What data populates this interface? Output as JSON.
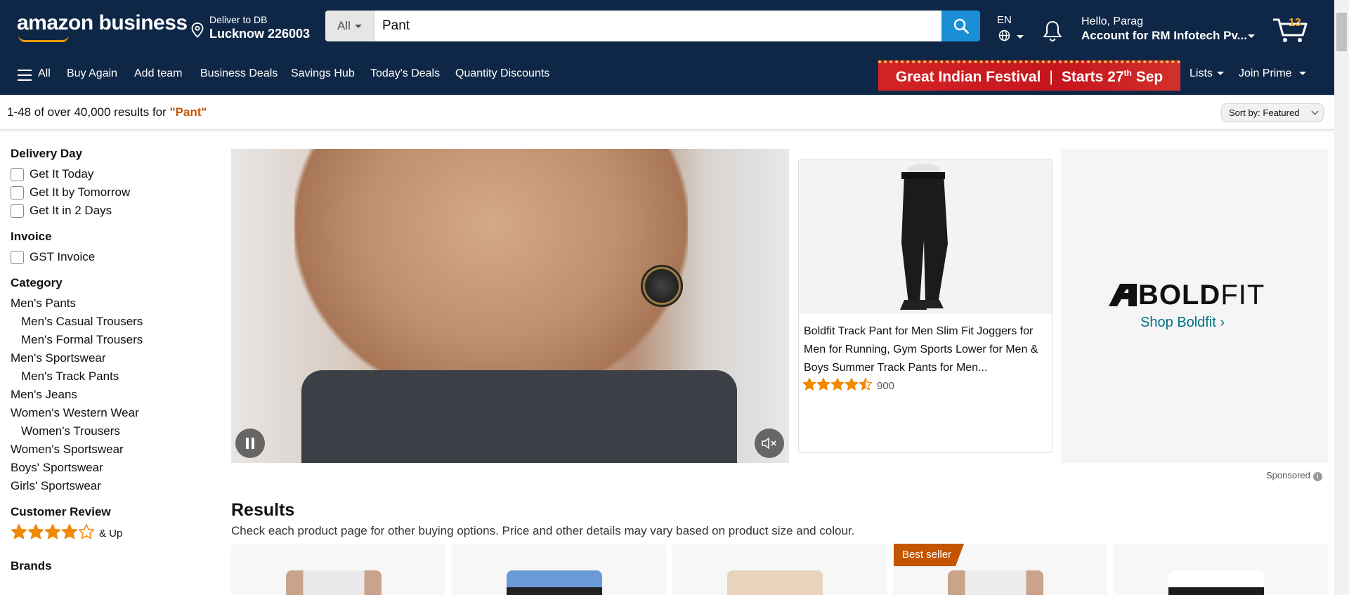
{
  "header": {
    "logo_text": "amazon business",
    "deliver_line1": "Deliver to DB",
    "deliver_line2": "Lucknow 226003",
    "search": {
      "category": "All",
      "value": "Pant"
    },
    "lang": "EN",
    "account_line1": "Hello, Parag",
    "account_line2": "Account for RM Infotech Pv...",
    "cart_count": "13"
  },
  "nav": {
    "all": "All",
    "items": [
      "Buy Again",
      "Add team",
      "Business Deals",
      "Savings Hub",
      "Today's Deals",
      "Quantity Discounts"
    ],
    "banner_text_a": "Great Indian Festival",
    "banner_text_b": "Starts 27",
    "banner_sup": "th",
    "banner_text_c": " Sep",
    "lists": "Lists",
    "join_prime": "Join Prime"
  },
  "results_bar": {
    "count_text": "1-48 of over 40,000 results for ",
    "query": "\"Pant\"",
    "sort_label": "Sort by:",
    "sort_value": "Featured"
  },
  "sidebar": {
    "delivery_title": "Delivery Day",
    "delivery_options": [
      "Get It Today",
      "Get It by Tomorrow",
      "Get It in 2 Days"
    ],
    "invoice_title": "Invoice",
    "invoice_option": "GST Invoice",
    "category_title": "Category",
    "categories": [
      {
        "label": "Men's Pants",
        "sub": false
      },
      {
        "label": "Men's Casual Trousers",
        "sub": true
      },
      {
        "label": "Men's Formal Trousers",
        "sub": true
      },
      {
        "label": "Men's Sportswear",
        "sub": false
      },
      {
        "label": "Men's Track Pants",
        "sub": true
      },
      {
        "label": "Men's Jeans",
        "sub": false
      },
      {
        "label": "Women's Western Wear",
        "sub": false
      },
      {
        "label": "Women's Trousers",
        "sub": true
      },
      {
        "label": "Women's Sportswear",
        "sub": false
      },
      {
        "label": "Boys' Sportswear",
        "sub": false
      },
      {
        "label": "Girls' Sportswear",
        "sub": false
      }
    ],
    "review_title": "Customer Review",
    "review_text": "& Up",
    "review_stars": 4,
    "brands_title": "Brands"
  },
  "sponsored_ad": {
    "product_title": "Boldfit Track Pant for Men Slim Fit Joggers for Men for Running, Gym Sports Lower for Men & Boys Summer Track Pants for Men...",
    "rating_stars": 4.5,
    "rating_count": "900",
    "brand_logo_a": "BOLD",
    "brand_logo_b": "FIT",
    "shop_link": "Shop Boldfit ›",
    "sponsored_label": "Sponsored"
  },
  "results": {
    "heading": "Results",
    "subheading": "Check each product page for other buying options. Price and other details may vary based on product size and colour.",
    "badge": "Best seller"
  },
  "colors": {
    "header_bg": "#0f2747",
    "search_button": "#1a8fd6",
    "query_highlight": "#c45500",
    "star": "#f08804",
    "link": "#007185"
  }
}
